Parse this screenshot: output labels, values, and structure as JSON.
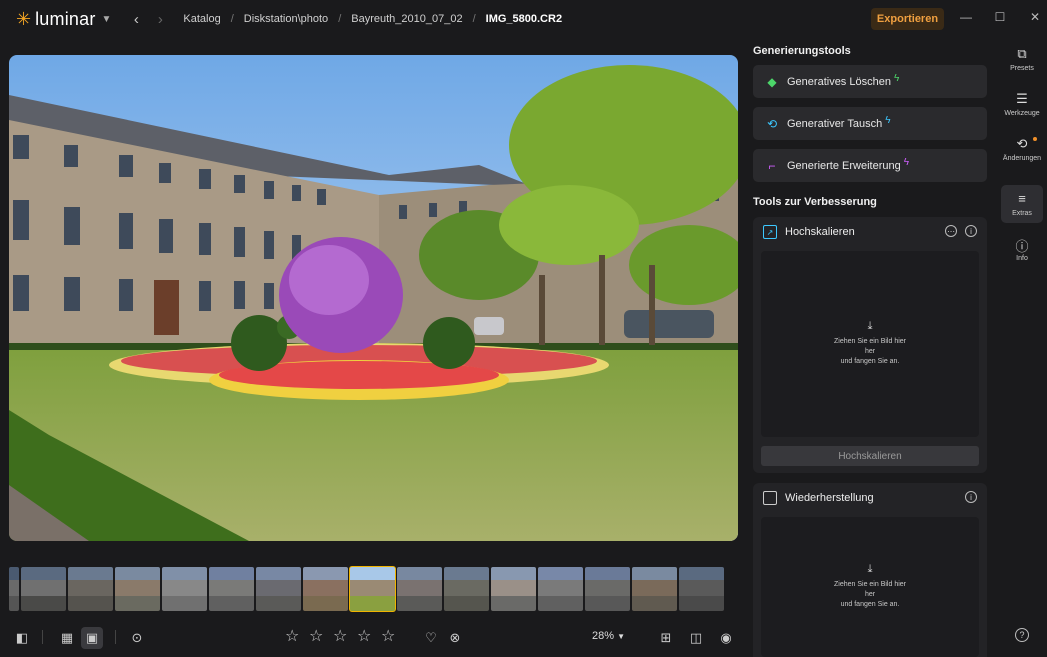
{
  "app": {
    "name": "luminar",
    "export_label": "Exportieren"
  },
  "breadcrumb": [
    "Katalog",
    "Diskstation\\photo",
    "Bayreuth_2010_07_02",
    "IMG_5800.CR2"
  ],
  "panel": {
    "gen_title": "Generierungstools",
    "gen_tools": [
      {
        "label": "Generatives Löschen",
        "icon": "eraser-icon",
        "color": "#4cd66a"
      },
      {
        "label": "Generativer Tausch",
        "icon": "swap-icon",
        "color": "#3cc8ff"
      },
      {
        "label": "Generierte Erweiterung",
        "icon": "expand-icon",
        "color": "#d060ff"
      }
    ],
    "improve_title": "Tools zur Verbesserung",
    "upscale": {
      "title": "Hochskalieren",
      "drop_line1": "Ziehen Sie ein Bild hier",
      "drop_line2": "her",
      "drop_line3": "und fangen Sie an.",
      "button": "Hochskalieren"
    },
    "restore": {
      "title": "Wiederherstellung",
      "drop_line1": "Ziehen Sie ein Bild hier",
      "drop_line2": "her",
      "drop_line3": "und fangen Sie an."
    }
  },
  "rail": [
    {
      "label": "Presets",
      "icon": "presets-icon"
    },
    {
      "label": "Werkzeuge",
      "icon": "sliders-icon"
    },
    {
      "label": "Änderungen",
      "icon": "history-icon"
    },
    {
      "label": "Extras",
      "icon": "list-icon"
    },
    {
      "label": "Info",
      "icon": "info-icon"
    }
  ],
  "toolbar": {
    "zoom": "28%",
    "rating": 0
  },
  "filmstrip": {
    "count": 15,
    "selected_index": 7
  }
}
